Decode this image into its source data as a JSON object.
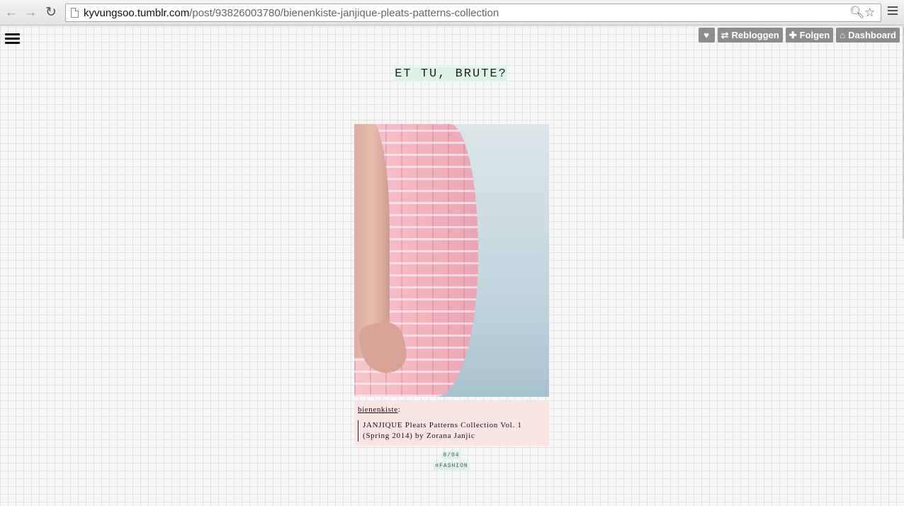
{
  "browser": {
    "url_host": "kyvungsoo.tumblr.com",
    "url_path": "/post/93826003780/bienenkiste-janjique-pleats-patterns-collection"
  },
  "icons": {
    "back": "arrow-left-icon",
    "forward": "arrow-right-icon",
    "reload": "reload-icon",
    "zoom": "magnifier-icon",
    "bookmark": "star-icon",
    "menu": "hamburger-icon"
  },
  "tumblr_controls": {
    "reblog_label": "Rebloggen",
    "follow_label": "Folgen",
    "dashboard_label": "Dashboard"
  },
  "blog": {
    "title": "ET TU, BRUTE?"
  },
  "post": {
    "source_name": "bienenkiste",
    "quote": "JANJIQUE Pleats Patterns Collection Vol. 1 (Spring 2014) by Zorana Janjic",
    "date": "8/04",
    "tag": "#FASHION"
  },
  "colors": {
    "title_highlight": "#dff2e8",
    "caption_bg": "#fbe4e4",
    "control_bg": "#8d8d8d"
  }
}
